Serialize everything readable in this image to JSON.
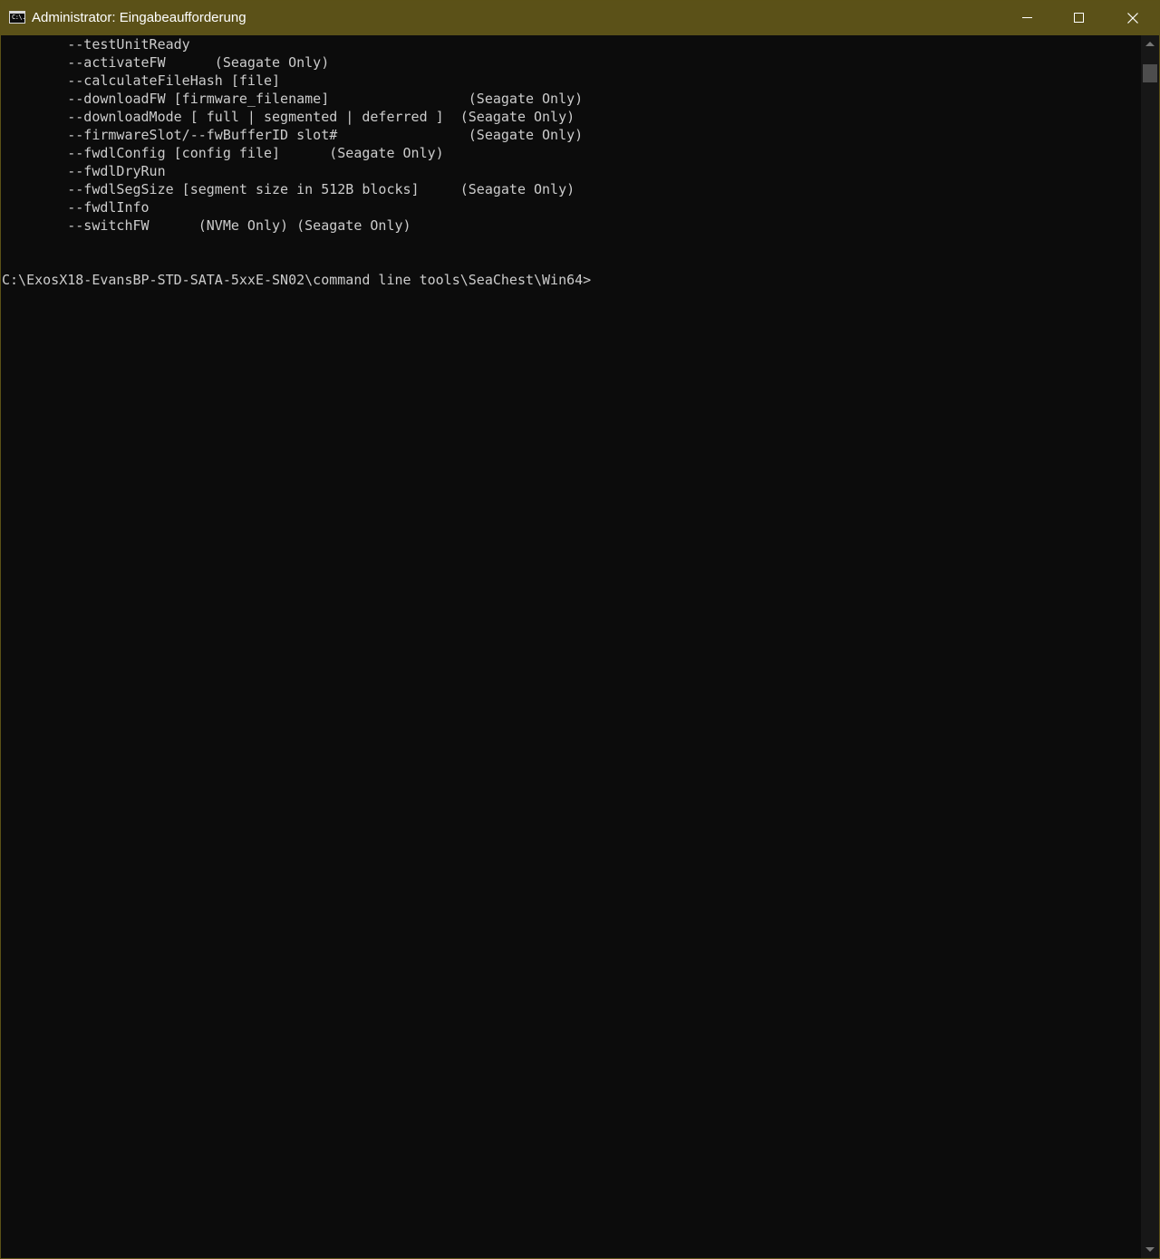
{
  "window": {
    "title": "Administrator: Eingabeaufforderung",
    "icon": "cmd-icon",
    "icon_text": "C:\\.",
    "titlebar_color": "#5b5118"
  },
  "controls": {
    "minimize": "minimize-icon",
    "maximize": "maximize-icon",
    "close": "close-icon"
  },
  "console": {
    "text_color": "#cccccc",
    "background": "#0c0c0c",
    "lines": [
      "        --testUnitReady",
      "        --activateFW      (Seagate Only)",
      "        --calculateFileHash [file]",
      "        --downloadFW [firmware_filename]                 (Seagate Only)",
      "        --downloadMode [ full | segmented | deferred ]  (Seagate Only)",
      "        --firmwareSlot/--fwBufferID slot#                (Seagate Only)",
      "        --fwdlConfig [config file]      (Seagate Only)",
      "        --fwdlDryRun",
      "        --fwdlSegSize [segment size in 512B blocks]     (Seagate Only)",
      "        --fwdlInfo",
      "        --switchFW      (NVMe Only) (Seagate Only)",
      "",
      "",
      "C:\\ExosX18-EvansBP-STD-SATA-5xxE-SN02\\command line tools\\SeaChest\\Win64>"
    ]
  }
}
